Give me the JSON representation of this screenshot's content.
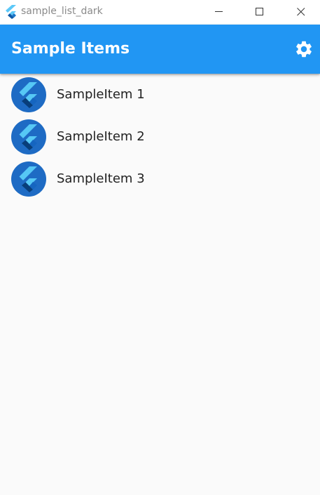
{
  "window": {
    "title": "sample_list_dark",
    "app_icon": "flutter-icon",
    "controls": [
      "minimize-icon",
      "maximize-icon",
      "close-icon"
    ]
  },
  "appbar": {
    "title": "Sample Items",
    "action_icon": "gear-icon",
    "color": "#2196f3"
  },
  "list": {
    "items": [
      {
        "label": "SampleItem 1",
        "icon": "flutter-logo-icon"
      },
      {
        "label": "SampleItem 2",
        "icon": "flutter-logo-icon"
      },
      {
        "label": "SampleItem 3",
        "icon": "flutter-logo-icon"
      }
    ]
  },
  "colors": {
    "background": "#fafafa",
    "avatar": "#1e6bc4",
    "text": "#222222"
  }
}
